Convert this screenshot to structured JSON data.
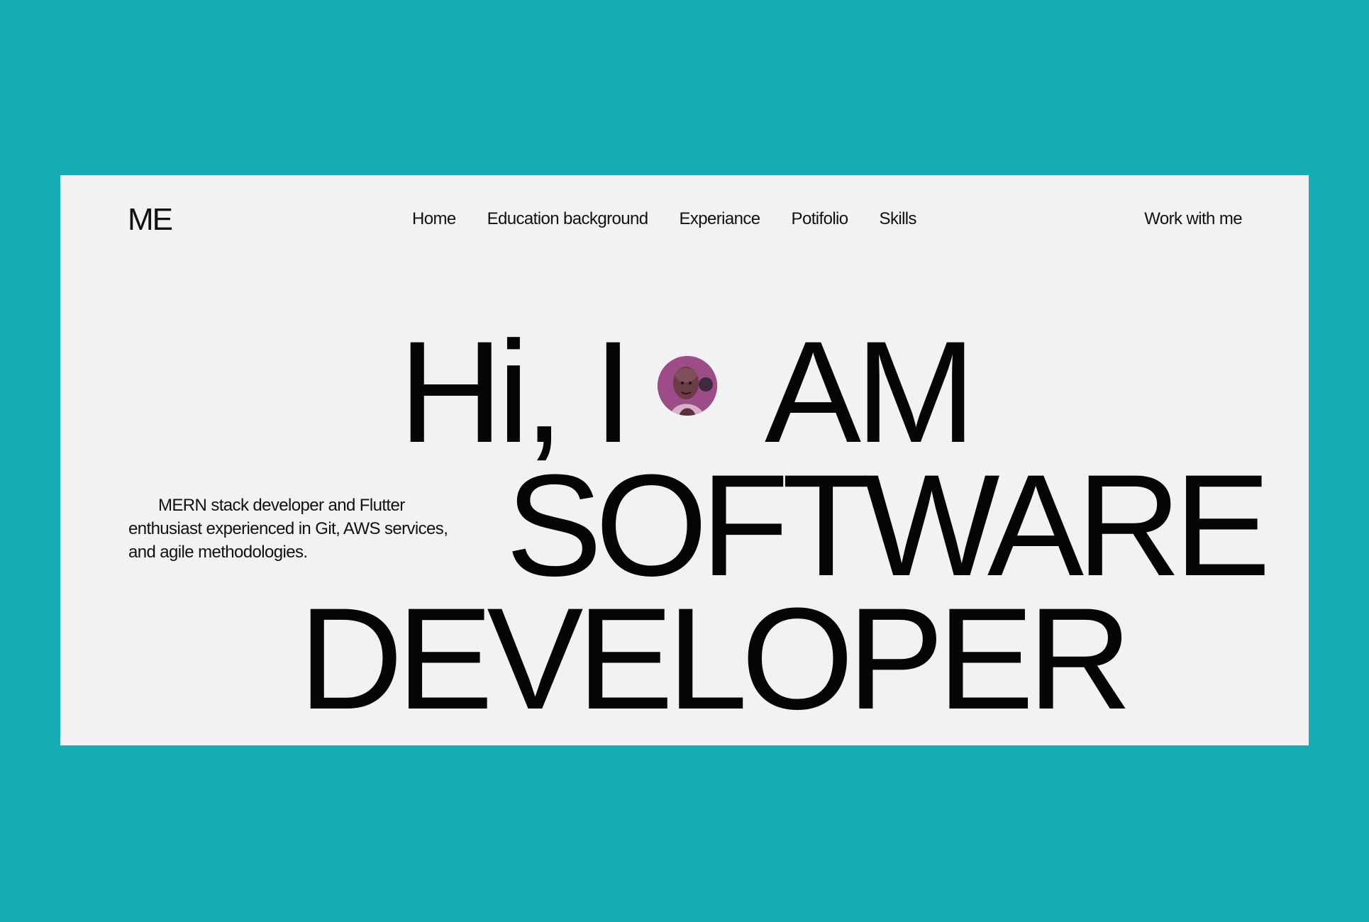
{
  "brand": {
    "logo_text": "ME"
  },
  "nav": {
    "items": [
      {
        "label": "Home"
      },
      {
        "label": "Education background"
      },
      {
        "label": "Experiance"
      },
      {
        "label": "Potifolio"
      },
      {
        "label": "Skills"
      }
    ],
    "cta_label": "Work with me"
  },
  "hero": {
    "line1_part1": "Hi, I",
    "line1_part2": "AM",
    "line2": "SOFTWARE",
    "line3": "DEVELOPER",
    "avatar_icon": "profile-photo"
  },
  "intro": {
    "text": "MERN stack developer and Flutter enthusiast experienced in Git, AWS services, and agile methodologies."
  },
  "colors": {
    "background": "#16acb5",
    "card": "#f2f2f2",
    "text": "#111111"
  }
}
